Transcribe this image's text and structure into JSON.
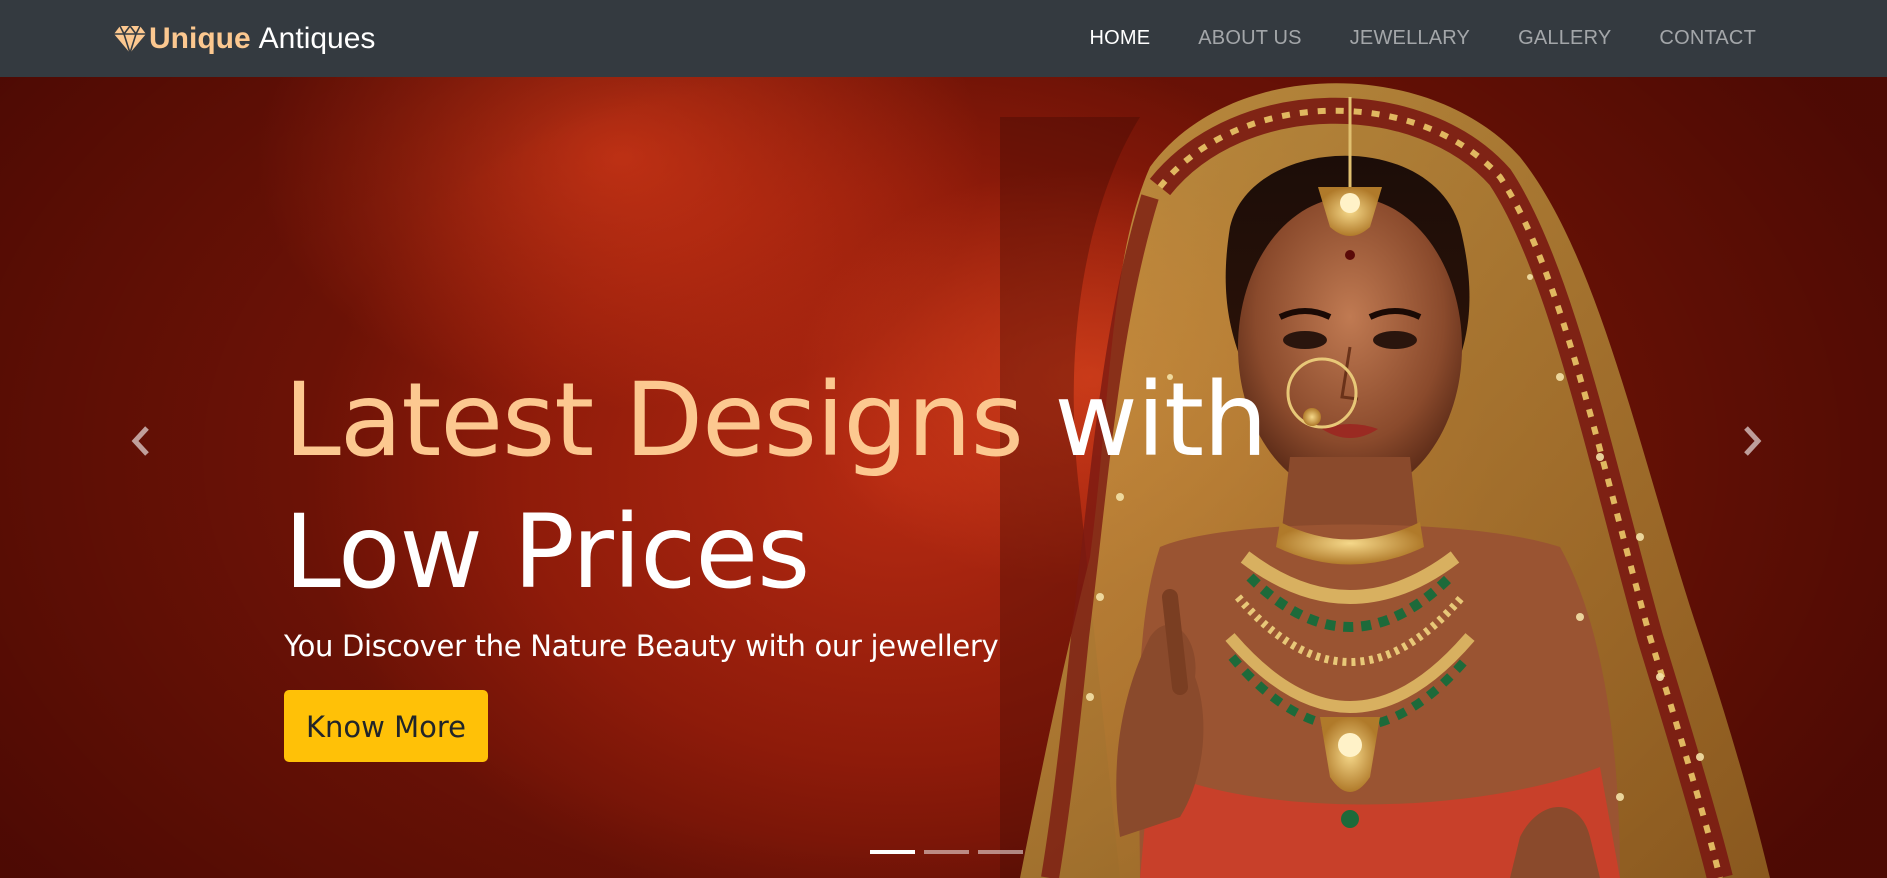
{
  "brand": {
    "strong": "Unique",
    "light": "Antiques",
    "icon": "diamond-icon"
  },
  "nav": {
    "items": [
      {
        "label": "HOME",
        "active": true
      },
      {
        "label": "ABOUT US",
        "active": false
      },
      {
        "label": "JEWELLARY",
        "active": false
      },
      {
        "label": "GALLERY",
        "active": false
      },
      {
        "label": "CONTACT",
        "active": false
      }
    ]
  },
  "hero": {
    "headline_accent": "Latest Designs",
    "headline_rest": " with Low Prices",
    "subtext": "You Discover the Nature Beauty with our jewellery",
    "cta_label": "Know More",
    "prev_icon": "chevron-left-icon",
    "next_icon": "chevron-right-icon",
    "slides": {
      "count": 3,
      "active": 1
    }
  },
  "colors": {
    "navbar_bg": "#343a40",
    "brand_accent": "#fcc890",
    "cta_bg": "#ffc107",
    "hero_bg": "#8e1b0a"
  }
}
